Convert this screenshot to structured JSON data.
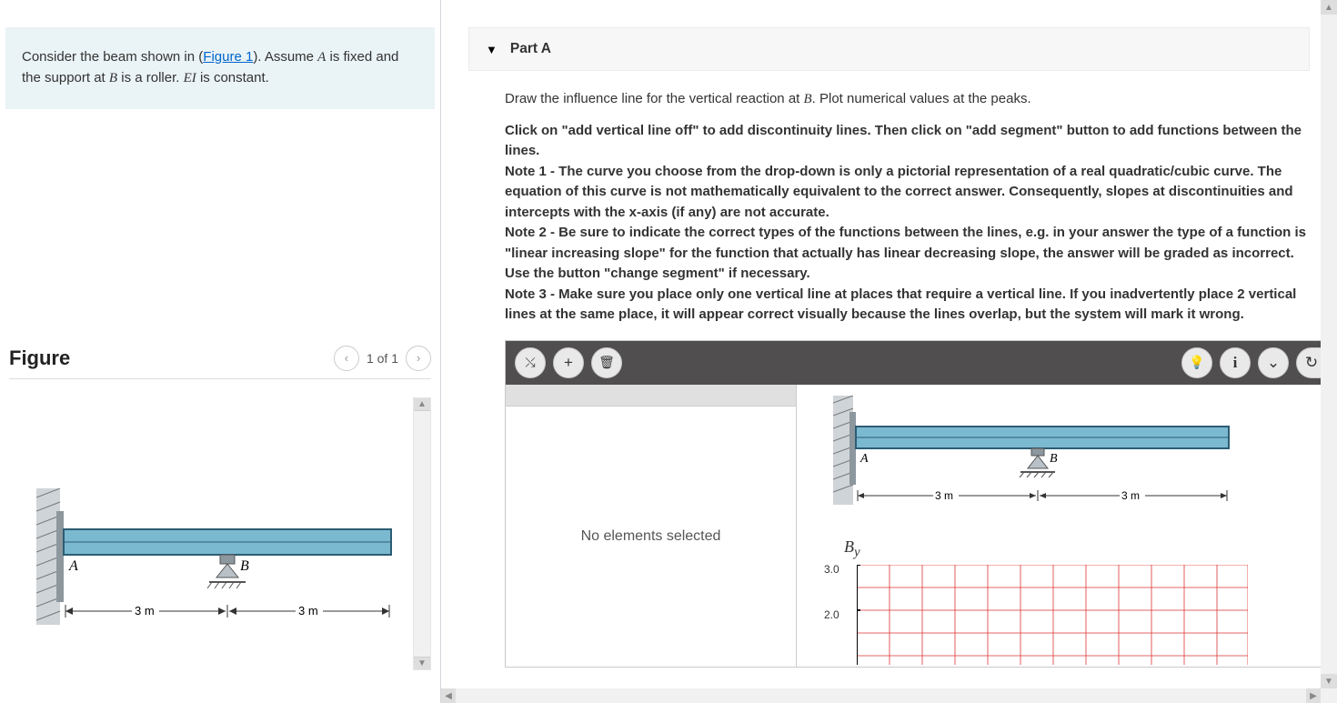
{
  "intro": {
    "pre": "Consider the beam shown in (",
    "link": "Figure 1",
    "post1": "). Assume ",
    "A": "A",
    "post2": " is fixed and the support at ",
    "B": "B",
    "post3": " is a roller. ",
    "EI": "EI",
    "post4": " is constant."
  },
  "figure": {
    "title": "Figure",
    "pager": "1 of 1",
    "labelA": "A",
    "labelB": "B",
    "dim1": "3 m",
    "dim2": "3 m"
  },
  "part": {
    "label": "Part A",
    "prompt_pre": "Draw the influence line for the vertical reaction at ",
    "prompt_B": "B",
    "prompt_post": ". Plot numerical values at the peaks.",
    "notes": "Click on \"add vertical line off\" to add discontinuity lines. Then click on \"add segment\" button to add functions between the lines.\nNote 1 - The curve you choose from the drop-down is only a pictorial representation of a real quadratic/cubic curve. The equation of this curve is not mathematically equivalent to the correct answer. Consequently, slopes at discontinuities and intercepts with the x-axis (if any) are not accurate.\nNote 2 - Be sure to indicate the correct types of the functions between the lines, e.g. in your answer the type of a function is \"linear increasing slope\" for the function that actually has linear decreasing slope, the answer will be graded as incorrect. Use the button \"change segment\" if necessary.\nNote 3 - Make sure you place only one vertical line at places that require a vertical line. If you inadvertently place 2 vertical lines at the same place, it will appear correct visually because the lines overlap, but the system will mark it wrong."
  },
  "widget": {
    "no_elements": "No elements selected",
    "mini": {
      "A": "A",
      "B": "B",
      "dim1": "3 m",
      "dim2": "3 m"
    },
    "ylabel_base": "B",
    "ylabel_sub": "y",
    "yticks": [
      "3.0",
      "2.0"
    ]
  },
  "icons": {
    "pencil": "✎",
    "plus": "+",
    "trash": "🗑",
    "bulb": "💡",
    "info": "i",
    "chevron": "⌄",
    "reset": "↻"
  }
}
